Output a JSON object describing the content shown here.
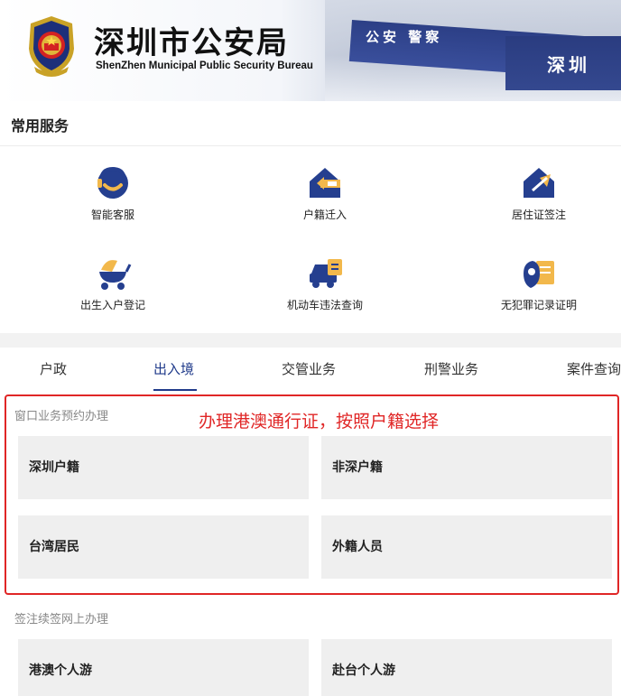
{
  "header": {
    "title_cn": "深圳市公安局",
    "title_en": "ShenZhen Municipal Public Security Bureau",
    "banner_text_1": "公安 警察",
    "banner_text_2": "深圳"
  },
  "common_services": {
    "heading": "常用服务",
    "items": [
      {
        "label": "智能客服",
        "icon": "customer-service-icon"
      },
      {
        "label": "户籍迁入",
        "icon": "house-move-in-icon"
      },
      {
        "label": "居住证签注",
        "icon": "residence-permit-icon"
      },
      {
        "label": "出生入户登记",
        "icon": "baby-stroller-icon"
      },
      {
        "label": "机动车违法查询",
        "icon": "car-violation-icon"
      },
      {
        "label": "无犯罪记录证明",
        "icon": "no-crime-certificate-icon"
      }
    ]
  },
  "tabs": {
    "items": [
      "户政",
      "出入境",
      "交管业务",
      "刑警业务",
      "案件查询"
    ],
    "active_index": 1
  },
  "window_booking": {
    "heading": "窗口业务预约办理",
    "annotation": "办理港澳通行证，按照户籍选择",
    "cards": [
      "深圳户籍",
      "非深户籍",
      "台湾居民",
      "外籍人员"
    ]
  },
  "endorsement": {
    "heading": "签注续签网上办理",
    "cards": [
      "港澳个人游",
      "赴台个人游"
    ]
  },
  "colors": {
    "brand_blue": "#1f3a8a",
    "icon_blue": "#253f8f",
    "icon_yellow": "#f2b84b",
    "annotation_red": "#e02626"
  }
}
